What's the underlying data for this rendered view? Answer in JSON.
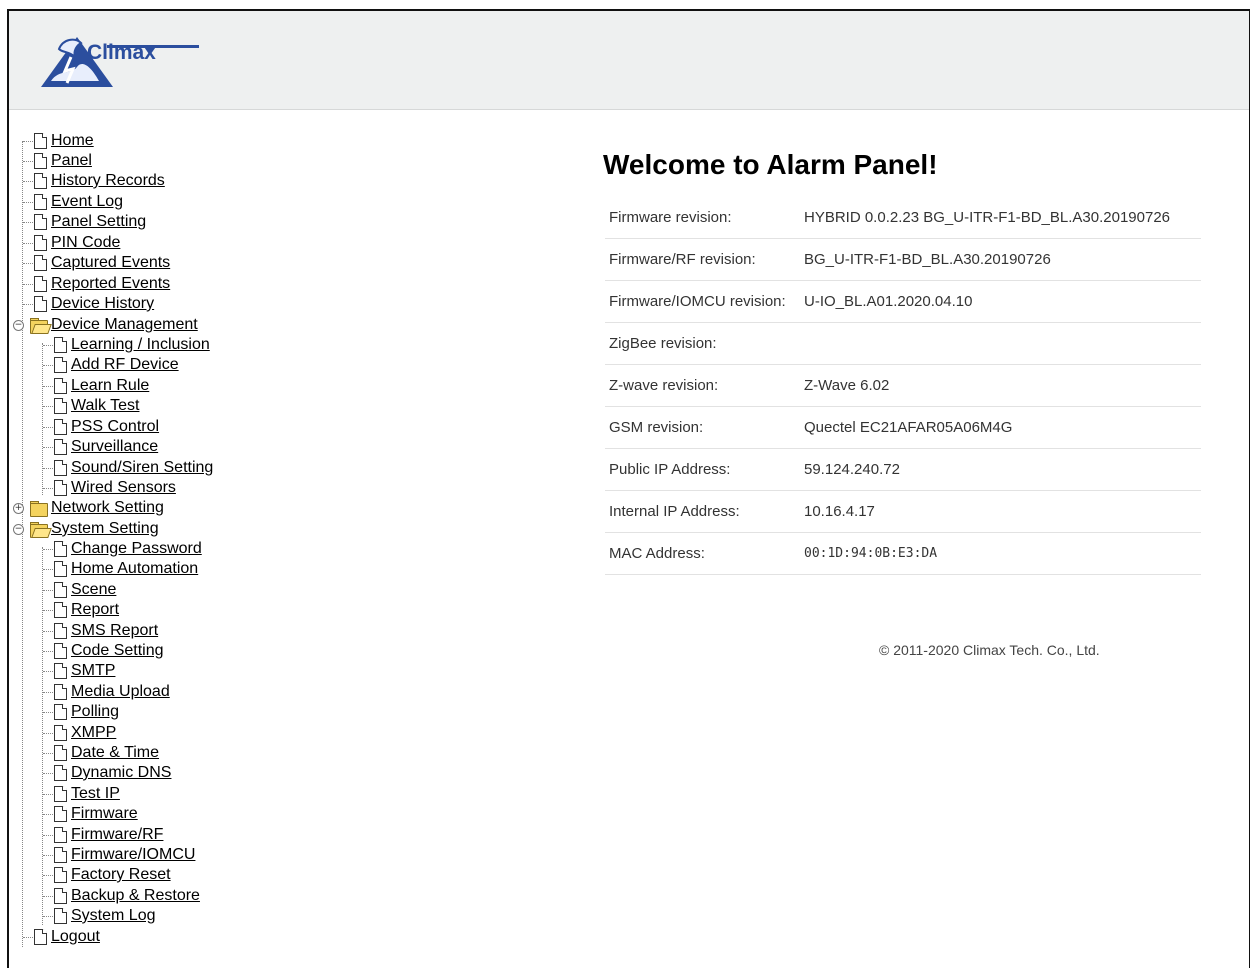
{
  "brand": {
    "logo_text": "Climax"
  },
  "nav": {
    "home": "Home",
    "panel": "Panel",
    "history_records": "History Records",
    "event_log": "Event Log",
    "panel_setting": "Panel Setting",
    "pin_code": "PIN Code",
    "captured_events": "Captured Events",
    "reported_events": "Reported Events",
    "device_history": "Device History",
    "device_management": {
      "label": "Device Management",
      "items": [
        "Learning / Inclusion",
        "Add RF Device",
        "Learn Rule",
        "Walk Test",
        "PSS Control",
        "Surveillance",
        "Sound/Siren Setting",
        "Wired Sensors"
      ]
    },
    "network_setting": "Network Setting",
    "system_setting": {
      "label": "System Setting",
      "items": [
        "Change Password",
        "Home Automation",
        "Scene",
        "Report",
        "SMS Report",
        "Code Setting",
        "SMTP",
        "Media Upload",
        "Polling",
        "XMPP",
        "Date & Time",
        "Dynamic DNS",
        "Test IP",
        "Firmware",
        "Firmware/RF",
        "Firmware/IOMCU",
        "Factory Reset",
        "Backup & Restore",
        "System Log"
      ]
    },
    "logout": "Logout"
  },
  "main": {
    "title": "Welcome to Alarm Panel!",
    "rows": [
      {
        "label": "Firmware revision:",
        "value": "HYBRID 0.0.2.23 BG_U-ITR-F1-BD_BL.A30.20190726"
      },
      {
        "label": "Firmware/RF revision:",
        "value": "BG_U-ITR-F1-BD_BL.A30.20190726"
      },
      {
        "label": "Firmware/IOMCU revision:",
        "value": "U-IO_BL.A01.2020.04.10"
      },
      {
        "label": "ZigBee revision:",
        "value": ""
      },
      {
        "label": "Z-wave revision:",
        "value": "Z-Wave 6.02"
      },
      {
        "label": "GSM revision:",
        "value": "Quectel EC21AFAR05A06M4G"
      },
      {
        "label": "Public IP Address:",
        "value": "59.124.240.72"
      },
      {
        "label": "Internal IP Address:",
        "value": "10.16.4.17"
      },
      {
        "label": "MAC Address:",
        "value": "00:1D:94:0B:E3:DA"
      }
    ],
    "footer": "© 2011-2020 Climax Tech. Co., Ltd."
  }
}
